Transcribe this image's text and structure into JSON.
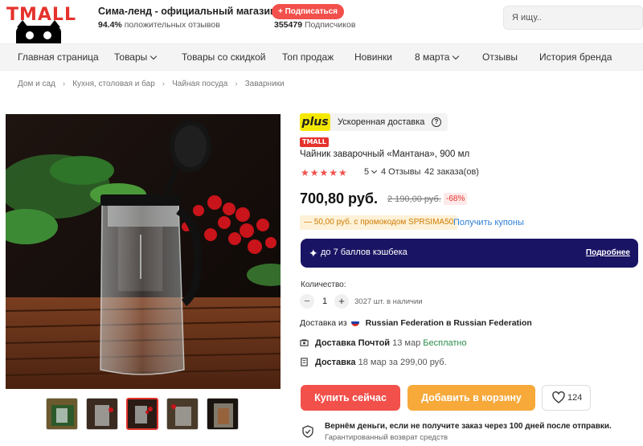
{
  "header": {
    "logo_text": "TMALL",
    "store_name": "Сима-ленд - официальный магазин",
    "positive_percent": "94.4%",
    "positive_label": "положительных отзывов",
    "subscribe_label": "+ Подписаться",
    "subscribers_count": "355479",
    "subscribers_label": "Подписчиков",
    "search_placeholder": "Я ищу.."
  },
  "nav": {
    "items": [
      {
        "label": "Главная страница"
      },
      {
        "label": "Товары"
      },
      {
        "label": "Товары со скидкой"
      },
      {
        "label": "Топ продаж"
      },
      {
        "label": "Новинки"
      },
      {
        "label": "8 марта"
      },
      {
        "label": "Отзывы"
      },
      {
        "label": "История бренда"
      }
    ]
  },
  "breadcrumbs": [
    "Дом и сад",
    "Кухня, столовая и бар",
    "Чайная посуда",
    "Заварники"
  ],
  "product": {
    "plus_logo": "plus",
    "plus_text": "Ускоренная доставка",
    "tmall_tag": "TMALL",
    "title": "Чайник заварочный «Мантана», 900 мл",
    "stars": "★★★★★",
    "rating": "5",
    "reviews": "4 Отзывы",
    "orders": "42 заказа(ов)",
    "price": "700,80 руб.",
    "old_price": "2 190,00 руб.",
    "discount": "-68%",
    "promo": "— 50,00 руб. с промокодом SPRSIMA50",
    "coupons_link": "Получить купоны",
    "cashback_text": "до 7 баллов кэшбека",
    "cashback_more": "Подробнее",
    "quantity_label": "Количество:",
    "quantity_value": "1",
    "quantity_minus": "−",
    "quantity_plus": "+",
    "stock": "3027 шт. в наличии",
    "delivery_from_prefix": "Доставка из",
    "delivery_from": "Russian Federation в Russian Federation",
    "post_title": "Доставка Почтой",
    "post_date": "13 мар",
    "post_price": "Бесплатно",
    "courier_title": "Доставка",
    "courier_info": "18 мар за 299,00 руб.",
    "buy_label": "Купить сейчас",
    "cart_label": "Добавить в корзину",
    "wishlist_count": "124",
    "guarantee_title": "Вернём деньги, если не получите заказ через 100 дней после отправки.",
    "guarantee_sub": "Гарантированный возврат средств"
  },
  "thumbnails": [
    {
      "id": "thumb-1"
    },
    {
      "id": "thumb-2"
    },
    {
      "id": "thumb-3",
      "active": true
    },
    {
      "id": "thumb-4"
    },
    {
      "id": "thumb-5"
    }
  ],
  "colors": {
    "accent": "#f2504b",
    "cart": "#f7a93a",
    "cashback": "#1a1464",
    "link": "#2d7fd5"
  }
}
